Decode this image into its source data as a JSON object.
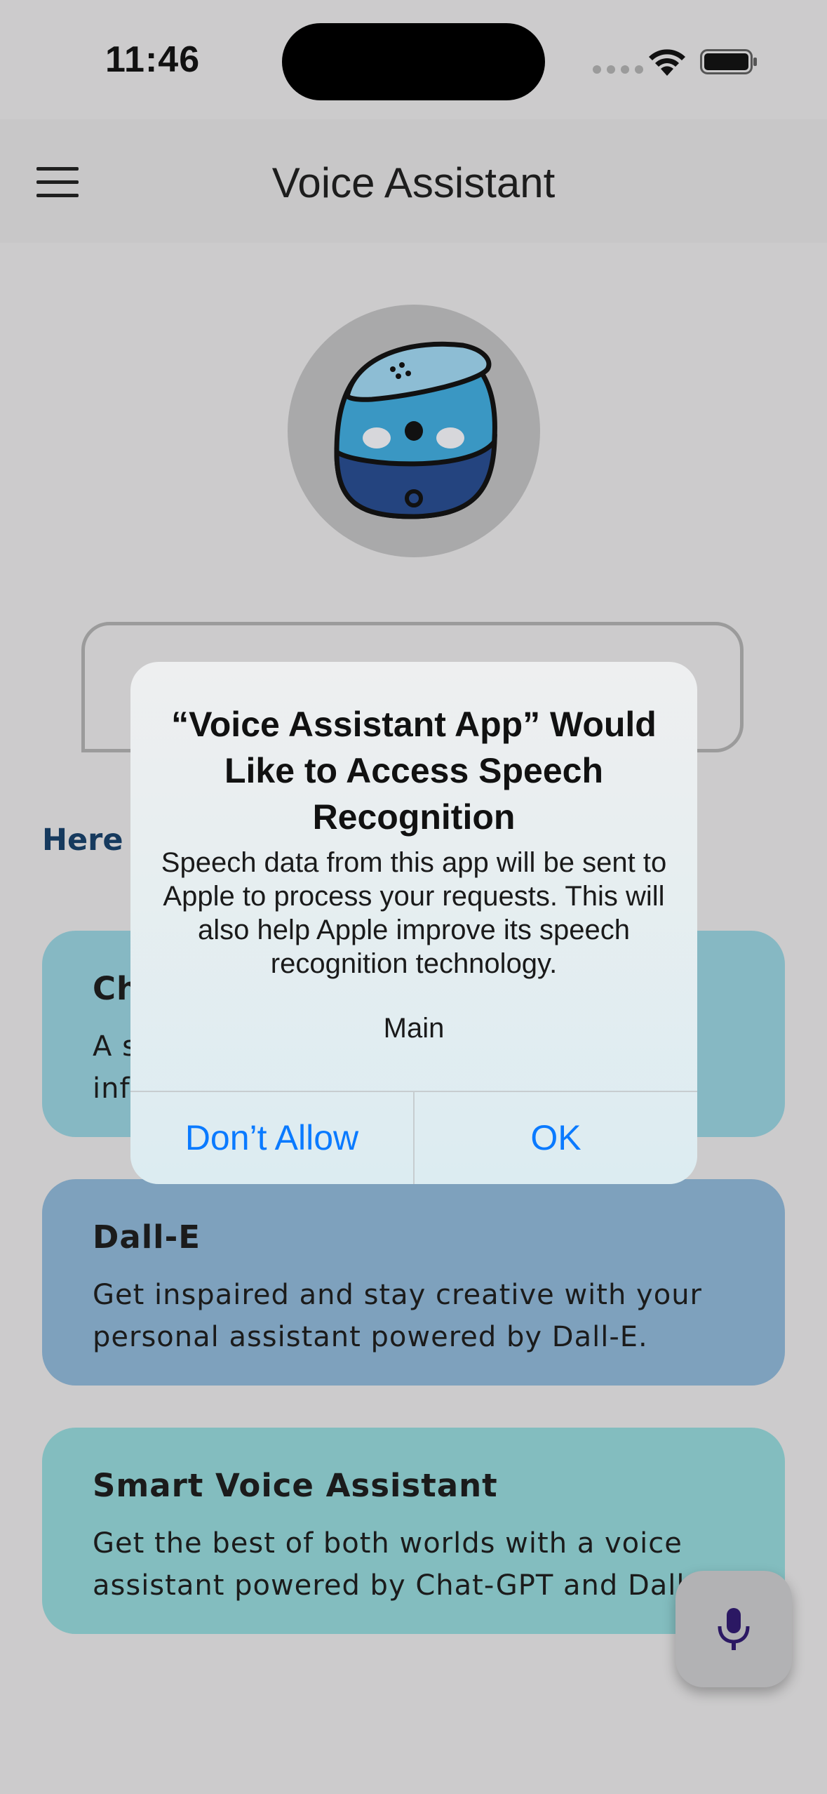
{
  "status_bar": {
    "time": "11:46"
  },
  "app_bar": {
    "title": "Voice Assistant",
    "menu_icon": "hamburger-menu-icon"
  },
  "main": {
    "section_heading": "Here",
    "cards": [
      {
        "title": "Ch",
        "description_line1": "A s",
        "description_line2": "inf",
        "color": "#86b8c3"
      },
      {
        "title": "Dall-E",
        "description_line1": "Get inspaired and stay creative with your",
        "description_line2": "personal assistant powered by Dall-E.",
        "color": "#7ea1bd"
      },
      {
        "title": "Smart Voice Assistant",
        "description_line1": "Get the best of both worlds with a voice",
        "description_line2": "assistant powered by Chat-GPT and Dall-E",
        "color": "#83bdbf"
      }
    ],
    "fab_icon": "microphone-icon"
  },
  "alert": {
    "title": "“Voice Assistant App” Would Like to Access Speech Recognition",
    "message": "Speech data from this app will be sent to Apple to process your requests. This will also help Apple improve its speech recognition technology.",
    "sub_text": "Main",
    "deny_label": "Don’t Allow",
    "ok_label": "OK",
    "button_color": "#0a7aff"
  }
}
